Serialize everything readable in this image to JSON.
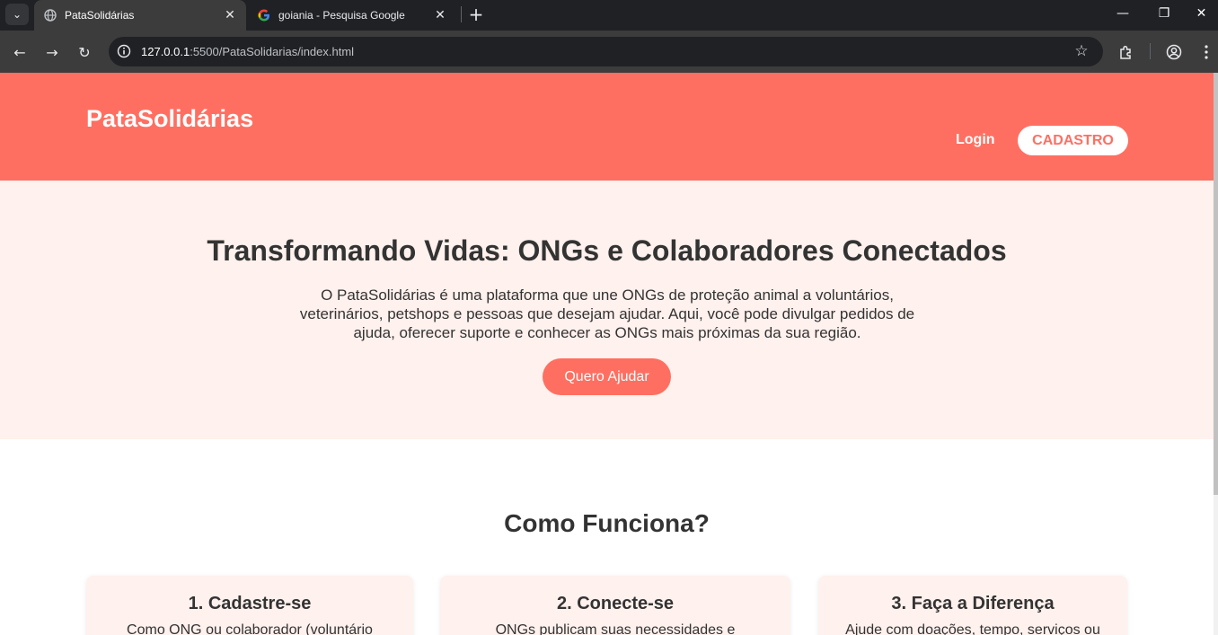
{
  "browser": {
    "tab_list_icon": "chevron-down-icon",
    "tabs": [
      {
        "title": "PataSolidárias",
        "favicon": "globe-icon",
        "close": "✕"
      },
      {
        "title": "goiania - Pesquisa Google",
        "favicon": "google-g-icon",
        "close": "✕"
      }
    ],
    "new_tab": "+",
    "window_controls": {
      "minimize": "—",
      "restore": "❐",
      "close": "✕"
    },
    "nav": {
      "back": "←",
      "forward": "→",
      "reload": "↻"
    },
    "url_host": "127.0.0.1",
    "url_path": ":5500/PataSolidarias/index.html",
    "bookmark_star": "☆"
  },
  "site": {
    "logo": "PataSolidárias",
    "nav": {
      "login": "Login",
      "cadastro": "CADASTRO"
    },
    "hero": {
      "title": "Transformando Vidas: ONGs e Colaboradores Conectados",
      "text": "O PataSolidárias é uma plataforma que une ONGs de proteção animal a voluntários, veterinários, petshops e pessoas que desejam ajudar. Aqui, você pode divulgar pedidos de ajuda, oferecer suporte e conhecer as ONGs mais próximas da sua região.",
      "button": "Quero Ajudar"
    },
    "how": {
      "title": "Como Funciona?",
      "cards": [
        {
          "title": "1. Cadastre-se",
          "text": "Como ONG ou colaborador (voluntário"
        },
        {
          "title": "2. Conecte-se",
          "text": "ONGs publicam suas necessidades e"
        },
        {
          "title": "3. Faça a Diferença",
          "text": "Ajude com doações, tempo, serviços ou"
        }
      ]
    }
  },
  "colors": {
    "brand": "#ff6f61",
    "hero_bg": "#fff1ed",
    "text": "#333333"
  }
}
